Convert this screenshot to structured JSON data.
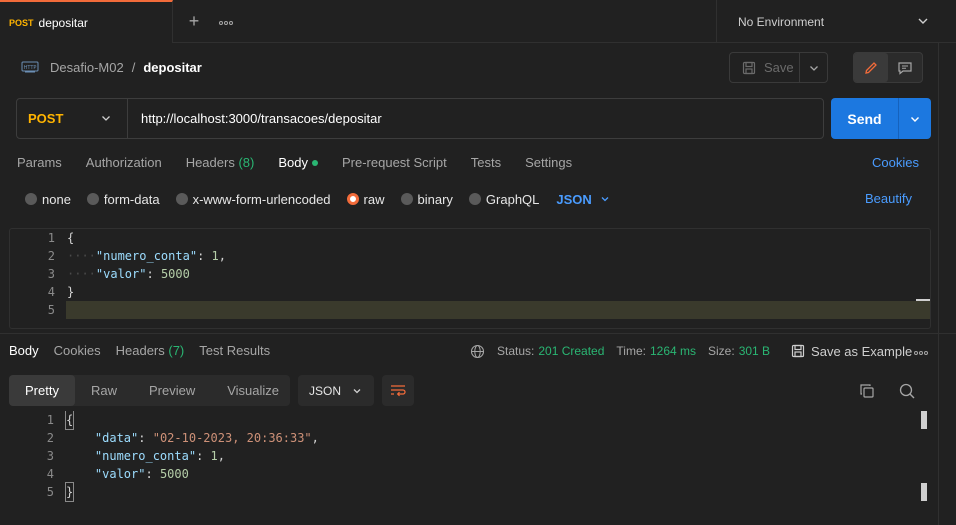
{
  "tabbar": {
    "active_tab": {
      "method": "POST",
      "name": "depositar"
    },
    "add_icon": "plus-icon",
    "more_icon": "more-horizontal-icon",
    "environment": "No Environment"
  },
  "breadcrumb": {
    "icon": "http-icon",
    "parent": "Desafio-M02",
    "separator": "/",
    "current": "depositar"
  },
  "actions": {
    "save_label": "Save",
    "edit_icon": "pencil-icon",
    "comment_icon": "comment-icon"
  },
  "request": {
    "method": "POST",
    "url": "http://localhost:3000/transacoes/depositar",
    "send_label": "Send"
  },
  "request_tabs": [
    {
      "label": "Params"
    },
    {
      "label": "Authorization"
    },
    {
      "label": "Headers",
      "count": "(8)"
    },
    {
      "label": "Body"
    },
    {
      "label": "Pre-request Script"
    },
    {
      "label": "Tests"
    },
    {
      "label": "Settings"
    }
  ],
  "cookies_label": "Cookies",
  "body_types": [
    {
      "label": "none",
      "selected": false
    },
    {
      "label": "form-data",
      "selected": false
    },
    {
      "label": "x-www-form-urlencoded",
      "selected": false
    },
    {
      "label": "raw",
      "selected": true
    },
    {
      "label": "binary",
      "selected": false
    },
    {
      "label": "GraphQL",
      "selected": false
    }
  ],
  "body_language": "JSON",
  "beautify_label": "Beautify",
  "request_body_lines": [
    {
      "n": "1",
      "text": "{"
    },
    {
      "n": "2",
      "key": "\"numero_conta\"",
      "value": "1",
      "comma": ","
    },
    {
      "n": "3",
      "key": "\"valor\"",
      "value": "5000",
      "comma": ""
    },
    {
      "n": "4",
      "text": "}"
    },
    {
      "n": "5",
      "text": ""
    }
  ],
  "response_tabs": [
    {
      "label": "Body"
    },
    {
      "label": "Cookies"
    },
    {
      "label": "Headers",
      "count": "(7)"
    },
    {
      "label": "Test Results"
    }
  ],
  "response_status": {
    "status_label": "Status:",
    "status_value": "201 Created",
    "time_label": "Time:",
    "time_value": "1264 ms",
    "size_label": "Size:",
    "size_value": "301 B",
    "save_example_label": "Save as Example"
  },
  "view_tabs": [
    {
      "label": "Pretty"
    },
    {
      "label": "Raw"
    },
    {
      "label": "Preview"
    },
    {
      "label": "Visualize"
    }
  ],
  "response_format": "JSON",
  "response_body_lines": [
    {
      "n": "1",
      "text": "{"
    },
    {
      "n": "2",
      "key": "\"data\"",
      "value": "\"02-10-2023, 20:36:33\"",
      "comma": ","
    },
    {
      "n": "3",
      "key": "\"numero_conta\"",
      "value": "1",
      "comma": ","
    },
    {
      "n": "4",
      "key": "\"valor\"",
      "value": "5000",
      "comma": ""
    },
    {
      "n": "5",
      "text": "}"
    }
  ],
  "colors": {
    "accent_orange": "#f26b3a",
    "method_post": "#ffb400",
    "send_blue": "#1c78e0",
    "link_blue": "#4a9cff",
    "status_green": "#2ab673"
  }
}
